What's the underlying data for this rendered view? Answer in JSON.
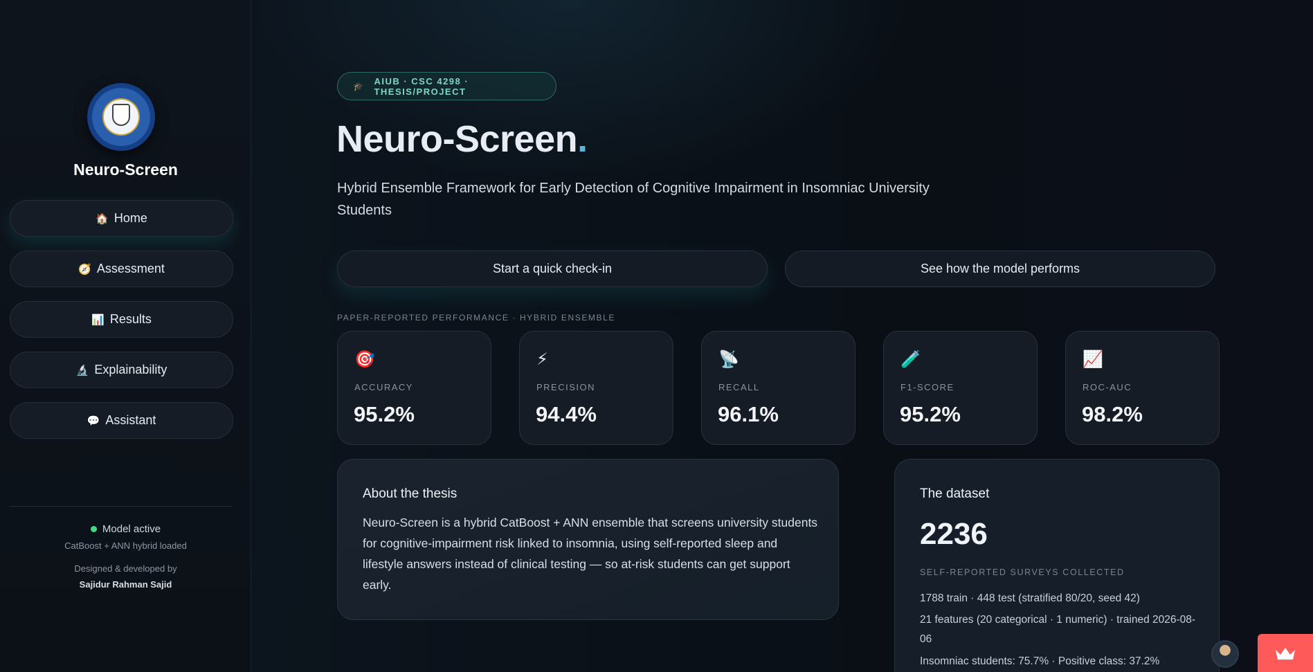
{
  "sidebar": {
    "brand": "Neuro-Screen",
    "nav": [
      {
        "icon": "house-icon",
        "glyph": "🏠",
        "label": "Home"
      },
      {
        "icon": "compass-icon",
        "glyph": "🧭",
        "label": "Assessment"
      },
      {
        "icon": "bar-chart-icon",
        "glyph": "📊",
        "label": "Results"
      },
      {
        "icon": "microscope-icon",
        "glyph": "🔬",
        "label": "Explainability"
      },
      {
        "icon": "speech-bubble-icon",
        "glyph": "💬",
        "label": "Assistant"
      }
    ],
    "status": "Model active",
    "status_sub": "CatBoost + ANN hybrid loaded",
    "credit_label": "Designed & developed by",
    "credit_name": "Sajidur Rahman Sajid"
  },
  "hero": {
    "pill": "AIUB · CSC 4298 · THESIS/PROJECT",
    "title": "Neuro-Screen",
    "title_accent": ".",
    "subtitle": "Hybrid Ensemble Framework for Early Detection of Cognitive Impairment in Insomniac University Students",
    "cta_primary": "Start a quick check-in",
    "cta_secondary": "See how the model performs"
  },
  "metrics": {
    "section_label": "PAPER-REPORTED PERFORMANCE · HYBRID ENSEMBLE",
    "items": [
      {
        "icon": "target-icon",
        "glyph": "🎯",
        "label": "ACCURACY",
        "value": "95.2%"
      },
      {
        "icon": "lightning-icon",
        "glyph": "⚡",
        "label": "PRECISION",
        "value": "94.4%"
      },
      {
        "icon": "satellite-icon",
        "glyph": "📡",
        "label": "RECALL",
        "value": "96.1%"
      },
      {
        "icon": "test-tube-icon",
        "glyph": "🧪",
        "label": "F1-SCORE",
        "value": "95.2%"
      },
      {
        "icon": "line-chart-icon",
        "glyph": "📈",
        "label": "ROC-AUC",
        "value": "98.2%"
      }
    ]
  },
  "about": {
    "title": "About the thesis",
    "text": "Neuro-Screen is a hybrid CatBoost + ANN ensemble that screens university students for cognitive-impairment risk linked to insomnia, using self-reported sleep and lifestyle answers instead of clinical testing — so at-risk students can get support early."
  },
  "dataset": {
    "title": "The dataset",
    "count": "2236",
    "count_label": "SELF-REPORTED SURVEYS COLLECTED",
    "lines": [
      "1788 train · 448 test (stratified 80/20, seed 42)",
      "21 features (20 categorical · 1 numeric) · trained 2026-08-06",
      "Insomniac students: 75.7% · Positive class: 37.2%"
    ]
  },
  "colors": {
    "accent": "#5fb4d6",
    "status_green": "#3ddc84",
    "pill_text": "#7fd6c4",
    "crown_button": "#ff5a5a"
  }
}
